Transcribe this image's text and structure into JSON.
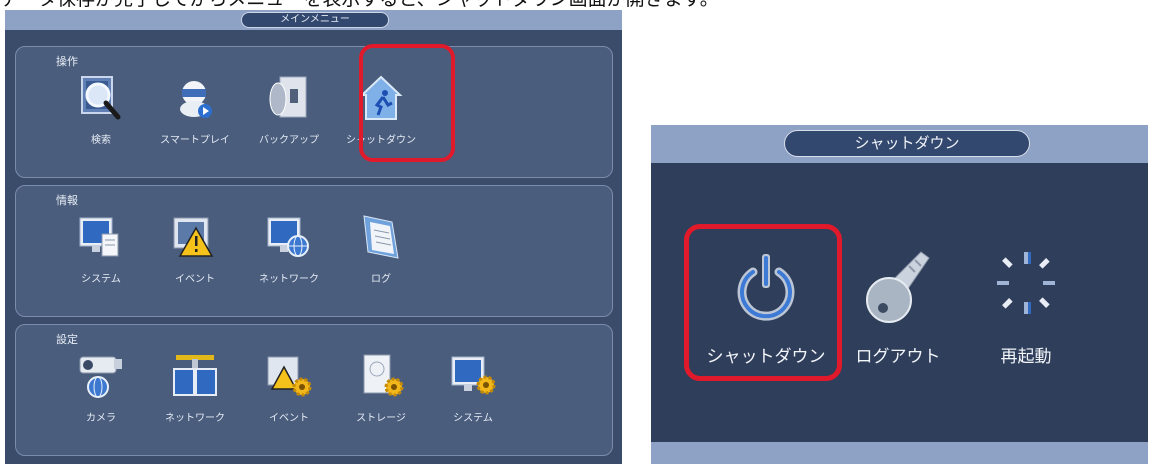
{
  "caption": "データ保存が完了してからメニューを表示すると、シャットダウン画面が開きます。",
  "main_menu": {
    "title": "メインメニュー",
    "sections": [
      {
        "label": "操作",
        "items": [
          {
            "label": "検索",
            "icon": "search-icon"
          },
          {
            "label": "スマートプレイ",
            "icon": "smart-play-icon"
          },
          {
            "label": "バックアップ",
            "icon": "backup-icon"
          },
          {
            "label": "シャットダウン",
            "icon": "shutdown-house-icon"
          }
        ]
      },
      {
        "label": "情報",
        "items": [
          {
            "label": "システム",
            "icon": "system-info-icon"
          },
          {
            "label": "イベント",
            "icon": "event-warning-icon"
          },
          {
            "label": "ネットワーク",
            "icon": "network-info-icon"
          },
          {
            "label": "ログ",
            "icon": "log-icon"
          }
        ]
      },
      {
        "label": "設定",
        "items": [
          {
            "label": "カメラ",
            "icon": "camera-icon"
          },
          {
            "label": "ネットワーク",
            "icon": "network-settings-icon"
          },
          {
            "label": "イベント",
            "icon": "event-settings-icon"
          },
          {
            "label": "ストレージ",
            "icon": "storage-icon"
          },
          {
            "label": "システム",
            "icon": "system-settings-icon"
          }
        ]
      }
    ]
  },
  "shutdown_menu": {
    "title": "シャットダウン",
    "items": [
      {
        "label": "シャットダウン",
        "icon": "power-icon"
      },
      {
        "label": "ログアウト",
        "icon": "key-icon"
      },
      {
        "label": "再起動",
        "icon": "restart-spinner-icon"
      }
    ]
  },
  "colors": {
    "highlight": "#e01a2a",
    "panel_bg": "#3b4c6a",
    "title_bar": "#8ea2c6"
  }
}
